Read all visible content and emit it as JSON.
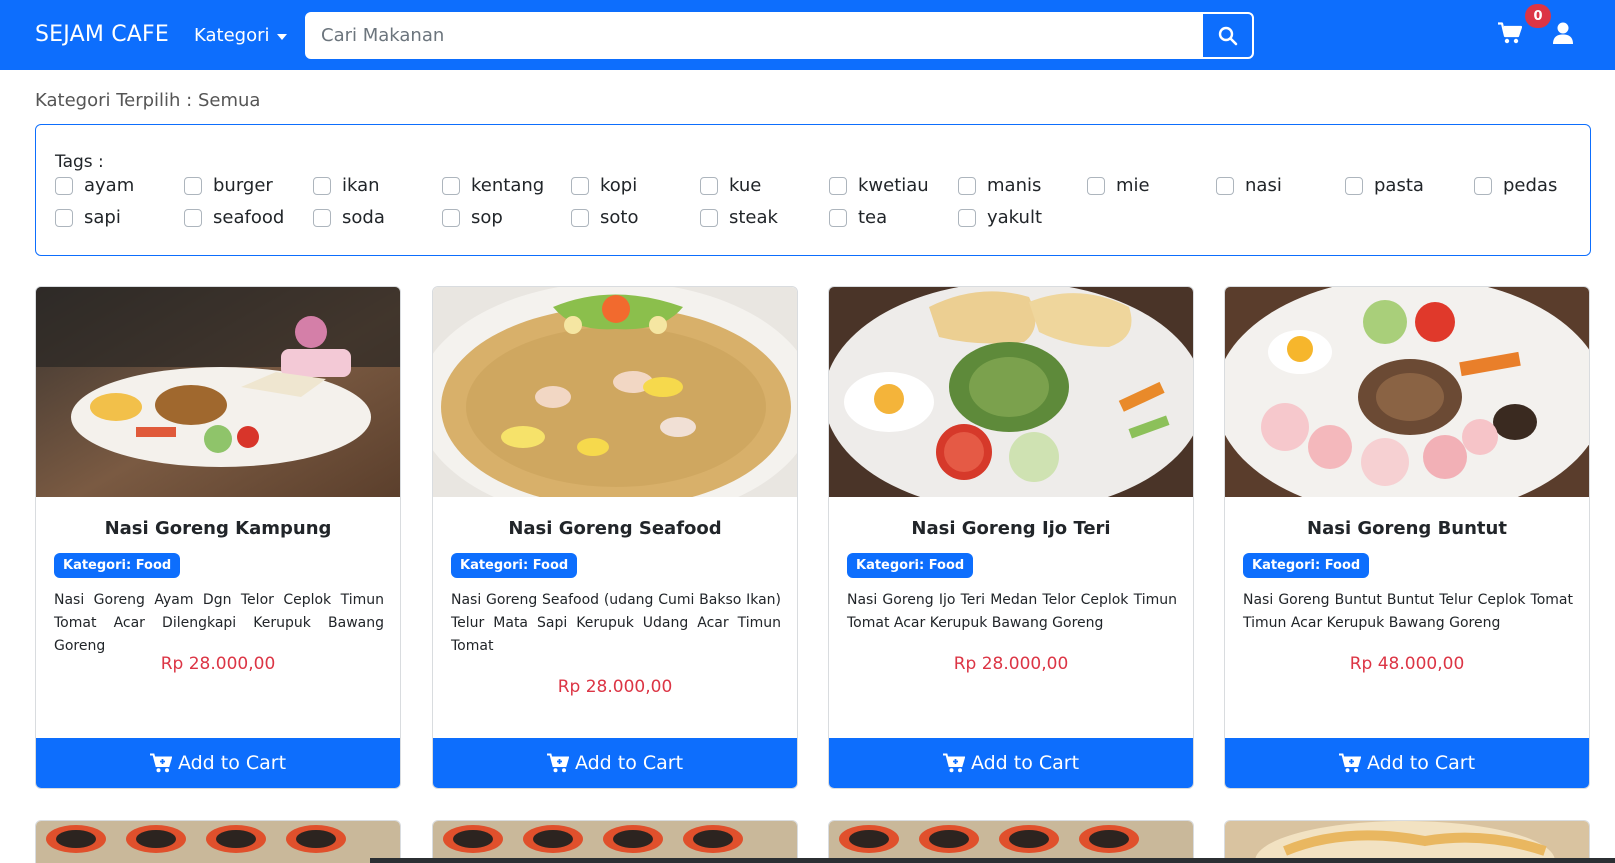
{
  "navbar": {
    "brand": "SEJAM CAFE",
    "kategori_label": "Kategori",
    "search_placeholder": "Cari Makanan",
    "cart_count": "0"
  },
  "filter": {
    "selected_label": "Kategori Terpilih : Semua",
    "tags_title": "Tags :",
    "tags": [
      "ayam",
      "burger",
      "ikan",
      "kentang",
      "kopi",
      "kue",
      "kwetiau",
      "manis",
      "mie",
      "nasi",
      "pasta",
      "pedas",
      "sapi",
      "seafood",
      "soda",
      "sop",
      "soto",
      "steak",
      "tea",
      "yakult"
    ]
  },
  "products": [
    {
      "name": "Nasi Goreng Kampung",
      "category": "Kategori: Food",
      "description": "Nasi Goreng Ayam Dgn Telor Ceplok Timun Tomat Acar Dilengkapi Kerupuk Bawang Goreng",
      "price": "Rp 28.000,00",
      "button": "Add to Cart"
    },
    {
      "name": "Nasi Goreng Seafood",
      "category": "Kategori: Food",
      "description": "Nasi Goreng Seafood (udang Cumi Bakso Ikan) Telur Mata Sapi Kerupuk Udang Acar Timun Tomat",
      "price": "Rp 28.000,00",
      "button": "Add to Cart"
    },
    {
      "name": "Nasi Goreng Ijo Teri",
      "category": "Kategori: Food",
      "description": "Nasi Goreng Ijo Teri Medan Telor Ceplok Timun Tomat Acar Kerupuk Bawang Goreng",
      "price": "Rp 28.000,00",
      "button": "Add to Cart"
    },
    {
      "name": "Nasi Goreng Buntut",
      "category": "Kategori: Food",
      "description": "Nasi Goreng Buntut Buntut Telur Ceplok Tomat Timun Acar Kerupuk Bawang Goreng",
      "price": "Rp 48.000,00",
      "button": "Add to Cart"
    }
  ],
  "colors": {
    "primary": "#0d6efd",
    "danger": "#dc3545",
    "text": "#212529"
  }
}
